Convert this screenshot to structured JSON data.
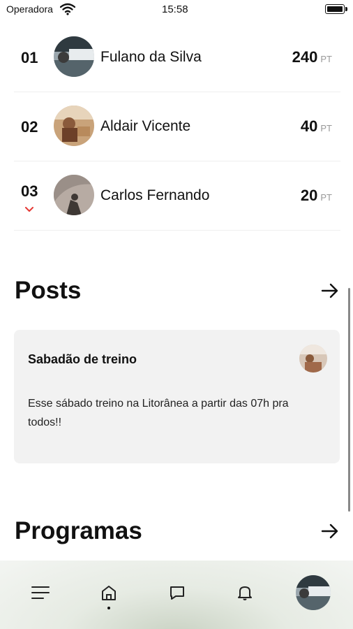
{
  "status_bar": {
    "carrier": "Operadora",
    "time": "15:58"
  },
  "ranking": [
    {
      "position": "01",
      "name": "Fulano da Silva",
      "score": "240",
      "unit": "PT",
      "avatar": "photo-avatar"
    },
    {
      "position": "02",
      "name": "Aldair Vicente",
      "score": "40",
      "unit": "PT",
      "avatar": "photo-avatar"
    },
    {
      "position": "03",
      "name": "Carlos Fernando",
      "score": "20",
      "unit": "PT",
      "avatar": "photo-avatar",
      "trend": "down",
      "trend_color": "#e53935"
    }
  ],
  "posts": {
    "title": "Posts",
    "items": [
      {
        "title": "Sabadão de treino",
        "body": "Esse sábado treino na Litorânea a partir das 07h pra todos!!"
      }
    ]
  },
  "programs": {
    "title": "Programas"
  },
  "tabbar": {
    "items": [
      "menu-icon",
      "home-icon",
      "chat-icon",
      "bell-icon",
      "profile-avatar"
    ],
    "active": "home-icon"
  }
}
